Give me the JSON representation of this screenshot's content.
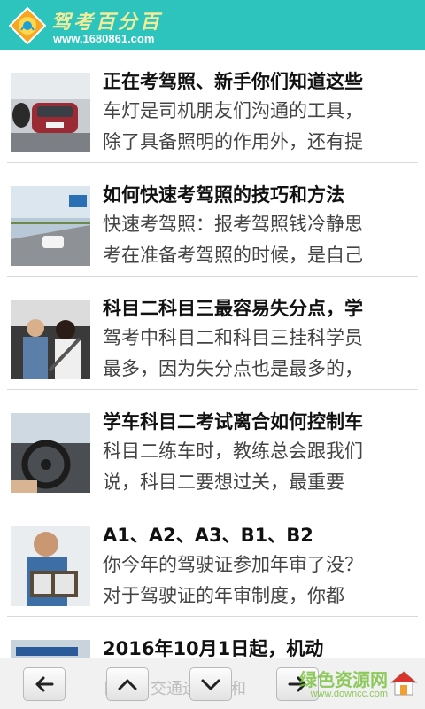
{
  "header": {
    "brand": "驾考百分百",
    "site": "www.1680861.com"
  },
  "articles": [
    {
      "title": "正在考驾照、新手你们知道这些",
      "line1": "车灯是司机朋友们沟通的工具，",
      "line2": "除了具备照明的作用外，还有提"
    },
    {
      "title": "如何快速考驾照的技巧和方法",
      "line1": "快速考驾照：报考驾照钱冷静思",
      "line2": "考在准备考驾照的时候，是自己"
    },
    {
      "title": "科目二科目三最容易失分点，学",
      "line1": "驾考中科目二和科目三挂科学员",
      "line2": "最多，因为失分点也是最多的，"
    },
    {
      "title": "学车科目二考试离合如何控制车",
      "line1": "科目二练车时，教练总会跟我们",
      "line2": "说，科目二要想过关，最重要"
    },
    {
      "title": "A1、A2、A3、B1、B2",
      "line1": "你今年的驾驶证参加年审了没？",
      "line2": "对于驾驶证的年审制度，你都"
    },
    {
      "title": "2016年10月1日起，机动",
      "line1": "日起，交通运输部和",
      "line2": ""
    }
  ],
  "bottombar": {
    "ghost_text": "日起，交通运输部和",
    "watermark": "绿色资源网",
    "watermark_sub": "www.downcc.com",
    "buttons": [
      "back",
      "scroll-up",
      "scroll-down",
      "forward",
      "home"
    ]
  },
  "colors": {
    "header": "#2cc4bd",
    "brand": "#f1ec9a",
    "watermark": "#7cc242"
  }
}
